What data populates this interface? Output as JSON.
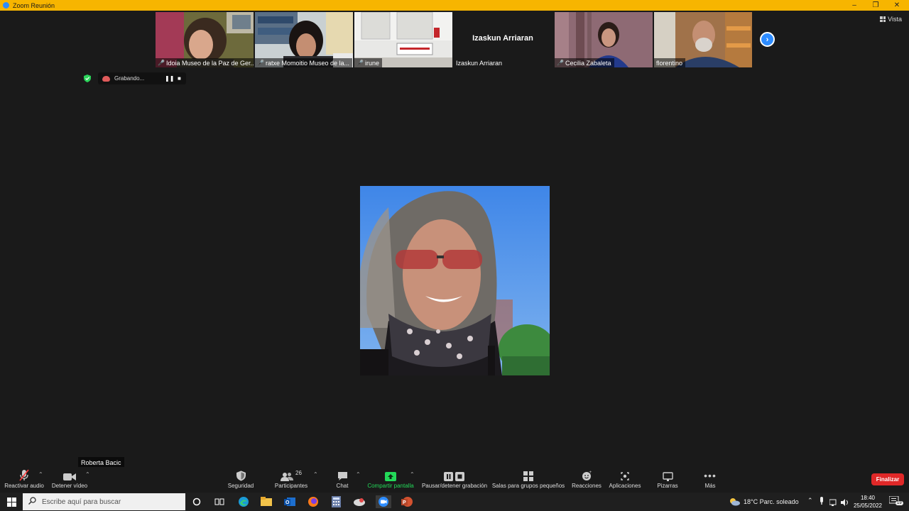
{
  "window": {
    "title": "Zoom Reunión",
    "controls": [
      "–",
      "❐",
      "✕"
    ]
  },
  "view_button": {
    "label": "Vista"
  },
  "participants_strip": [
    {
      "name": "Idoia Museo de la Paz de Ger...",
      "muted": true,
      "video": true
    },
    {
      "name": "ratxe Momoitio Museo de la...",
      "muted": true,
      "video": true
    },
    {
      "name": "irune",
      "muted": true,
      "video": true
    },
    {
      "name": "Izaskun Arriaran",
      "muted": false,
      "video": false,
      "display_name": "Izaskun Arriaran"
    },
    {
      "name": "Cecilia Zabaleta",
      "muted": true,
      "video": true
    },
    {
      "name": "florentino",
      "muted": false,
      "video": true
    }
  ],
  "recording": {
    "label": "Grabando..."
  },
  "active_speaker": {
    "name": "Roberta Bacic"
  },
  "toolbar": {
    "audio": "Reactivar audio",
    "video": "Detener vídeo",
    "security": "Seguridad",
    "participants": "Participantes",
    "participants_count": "26",
    "chat": "Chat",
    "share": "Compartir pantalla",
    "record": "Pausar/detener grabación",
    "breakout": "Salas para grupos pequeños",
    "reactions": "Reacciones",
    "apps": "Aplicaciones",
    "whiteboards": "Pizarras",
    "more": "Más",
    "end": "Finalizar"
  },
  "taskbar": {
    "search_placeholder": "Escribe aquí para buscar",
    "weather": "18°C  Parc. soleado",
    "time": "18:40",
    "date": "25/05/2022",
    "notification_count": "19"
  },
  "colors": {
    "title_bar": "#f7b500",
    "zoom_blue": "#2d8cff",
    "share_green": "#23d959",
    "end_red": "#e02828",
    "muted_red": "#ff3b3b"
  }
}
